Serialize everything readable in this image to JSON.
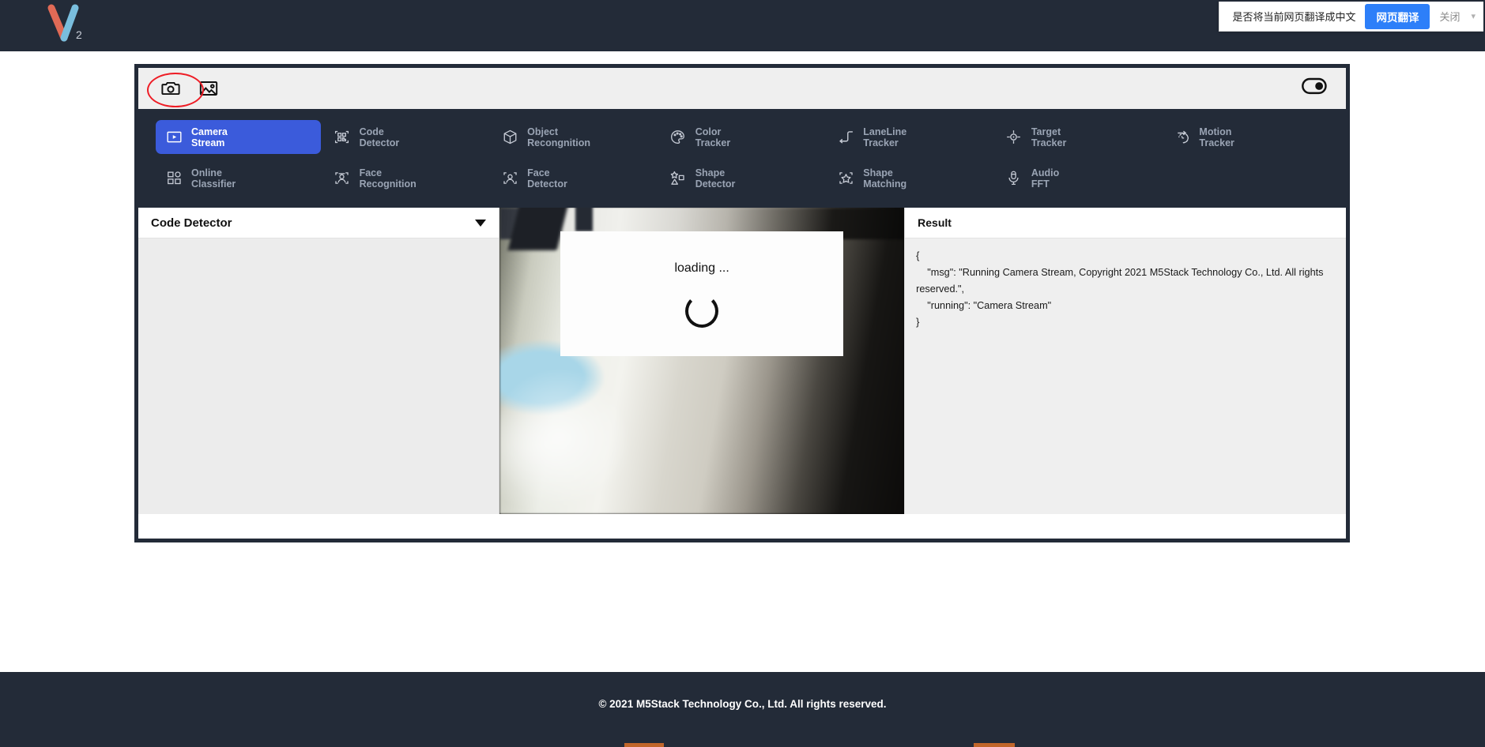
{
  "brand": {
    "logo_name": "v2-logo",
    "logo_subscript": "2",
    "orange": "#e06a56",
    "blue": "#79bede",
    "dark": "#232b38",
    "accent_blue": "#3b5bdb"
  },
  "translate_banner": {
    "message": "是否将当前网页翻译成中文",
    "primary_label": "网页翻译",
    "close_label": "关闭",
    "chevron": "chevron-down-icon"
  },
  "toolbar": {
    "camera_icon": "camera-icon",
    "image_icon": "image-icon",
    "toggle_icon": "toggle-switch-icon"
  },
  "functions": [
    {
      "label": "Camera\nStream",
      "icon": "video-play-icon",
      "active": true
    },
    {
      "label": "Code\nDetector",
      "icon": "qr-code-icon",
      "active": false
    },
    {
      "label": "Object\nRecongnition",
      "icon": "cube-icon",
      "active": false
    },
    {
      "label": "Color\nTracker",
      "icon": "palette-icon",
      "active": false
    },
    {
      "label": "LaneLine\nTracker",
      "icon": "lane-line-icon",
      "active": false
    },
    {
      "label": "Target\nTracker",
      "icon": "crosshair-icon",
      "active": false
    },
    {
      "label": "Motion\nTracker",
      "icon": "motion-speed-icon",
      "active": false
    },
    {
      "label": "Online\nClassifier",
      "icon": "grid-shapes-icon",
      "active": false
    },
    {
      "label": "Face\nRecognition",
      "icon": "face-scan-icon",
      "active": false
    },
    {
      "label": "Face\nDetector",
      "icon": "face-bracket-icon",
      "active": false
    },
    {
      "label": "Shape\nDetector",
      "icon": "shapes-icon",
      "active": false
    },
    {
      "label": "Shape\nMatching",
      "icon": "star-bracket-icon",
      "active": false
    },
    {
      "label": "Audio\nFFT",
      "icon": "microphone-icon",
      "active": false
    }
  ],
  "left_panel": {
    "selected_option": "Code Detector",
    "caret": "caret-down-icon"
  },
  "video": {
    "loading_text": "loading ...",
    "spinner": "spinner-icon"
  },
  "result": {
    "title": "Result",
    "json_text": "{\n    \"msg\": \"Running Camera Stream, Copyright 2021 M5Stack Technology Co., Ltd. All rights reserved.\",\n    \"running\": \"Camera Stream\"\n}"
  },
  "footer": {
    "copyright": "© 2021 M5Stack Technology Co., Ltd. All rights reserved."
  }
}
